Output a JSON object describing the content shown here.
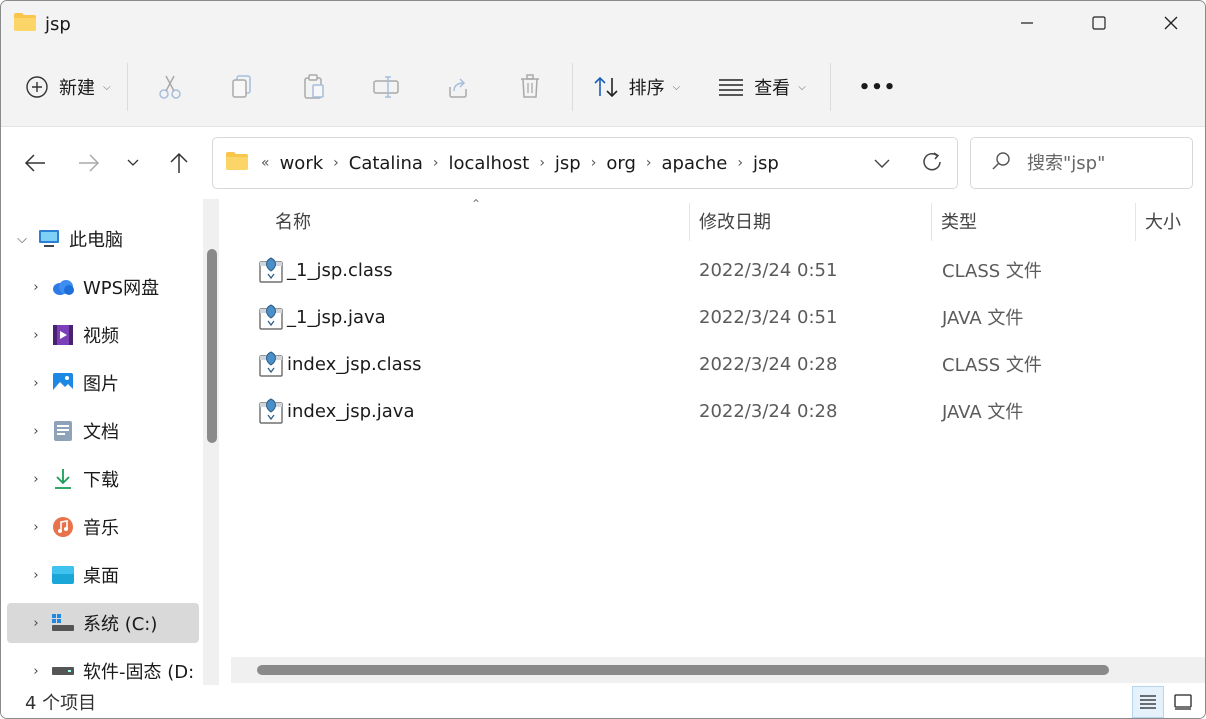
{
  "window": {
    "title": "jsp"
  },
  "toolbar": {
    "new_label": "新建",
    "sort_label": "排序",
    "view_label": "查看",
    "more_label": "•••"
  },
  "breadcrumb": {
    "overflow": "«",
    "items": [
      "work",
      "Catalina",
      "localhost",
      "jsp",
      "org",
      "apache",
      "jsp"
    ]
  },
  "search": {
    "placeholder": "搜索\"jsp\""
  },
  "sidebar": {
    "items": [
      {
        "label": "此电脑",
        "icon": "computer-icon",
        "expanded": true
      },
      {
        "label": "WPS网盘",
        "icon": "cloud-icon"
      },
      {
        "label": "视频",
        "icon": "video-icon"
      },
      {
        "label": "图片",
        "icon": "picture-icon"
      },
      {
        "label": "文档",
        "icon": "document-icon"
      },
      {
        "label": "下载",
        "icon": "download-icon"
      },
      {
        "label": "音乐",
        "icon": "music-icon"
      },
      {
        "label": "桌面",
        "icon": "desktop-icon"
      },
      {
        "label": "系统 (C:)",
        "icon": "drive-c-icon",
        "selected": true
      },
      {
        "label": "软件-固态 (D:",
        "icon": "drive-d-icon"
      }
    ]
  },
  "columns": {
    "name": "名称",
    "date": "修改日期",
    "type": "类型",
    "size": "大小"
  },
  "files": [
    {
      "name": "_1_jsp.class",
      "date": "2022/3/24 0:51",
      "type": "CLASS 文件"
    },
    {
      "name": "_1_jsp.java",
      "date": "2022/3/24 0:51",
      "type": "JAVA 文件"
    },
    {
      "name": "index_jsp.class",
      "date": "2022/3/24 0:28",
      "type": "CLASS 文件"
    },
    {
      "name": "index_jsp.java",
      "date": "2022/3/24 0:28",
      "type": "JAVA 文件"
    }
  ],
  "status": {
    "count_text": "4 个项目"
  },
  "colors": {
    "accent": "#0067c0",
    "folder": "#f8c64a",
    "selection": "#d9d9d9",
    "scrollbar": "#8a8a8a"
  }
}
